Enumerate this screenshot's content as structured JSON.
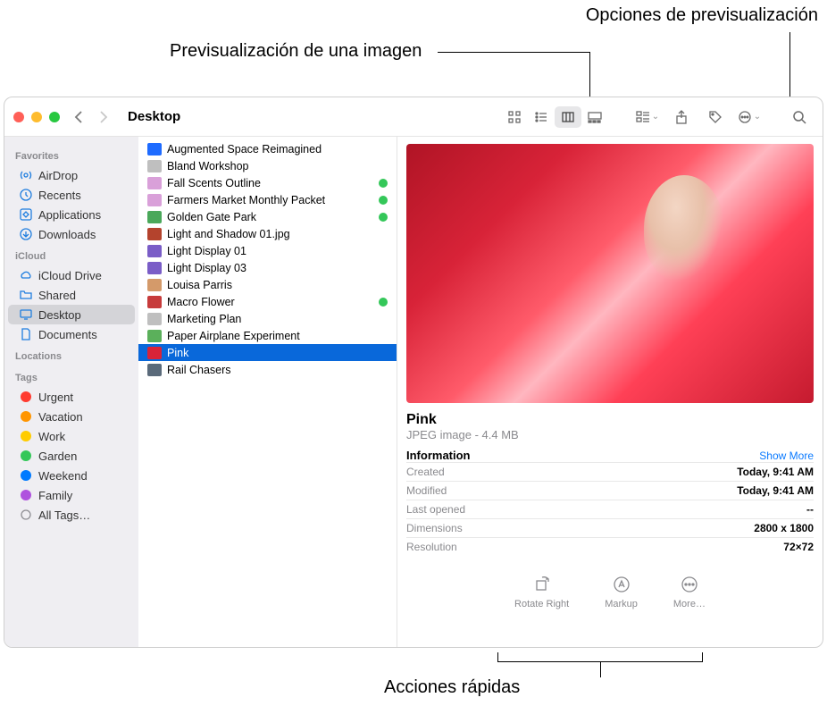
{
  "callouts": {
    "preview_options": "Opciones de previsualización",
    "image_preview": "Previsualización de una imagen",
    "quick_actions": "Acciones rápidas"
  },
  "window": {
    "location": "Desktop"
  },
  "sidebar": {
    "sections": {
      "favorites": "Favorites",
      "icloud": "iCloud",
      "locations": "Locations",
      "tags": "Tags"
    },
    "favorites": [
      {
        "label": "AirDrop",
        "icon": "airdrop"
      },
      {
        "label": "Recents",
        "icon": "clock"
      },
      {
        "label": "Applications",
        "icon": "apps"
      },
      {
        "label": "Downloads",
        "icon": "download"
      }
    ],
    "icloud": [
      {
        "label": "iCloud Drive",
        "icon": "cloud"
      },
      {
        "label": "Shared",
        "icon": "folder"
      },
      {
        "label": "Desktop",
        "icon": "desktop",
        "active": true
      },
      {
        "label": "Documents",
        "icon": "doc"
      }
    ],
    "tags": [
      {
        "label": "Urgent",
        "color": "#ff3b30"
      },
      {
        "label": "Vacation",
        "color": "#ff9500"
      },
      {
        "label": "Work",
        "color": "#ffcc00"
      },
      {
        "label": "Garden",
        "color": "#34c759"
      },
      {
        "label": "Weekend",
        "color": "#007aff"
      },
      {
        "label": "Family",
        "color": "#af52de"
      },
      {
        "label": "All Tags…",
        "color": "",
        "all": true
      }
    ]
  },
  "files": [
    {
      "name": "Augmented Space Reimagined",
      "icon": "pres",
      "tag": false
    },
    {
      "name": "Bland Workshop",
      "icon": "doc",
      "tag": false
    },
    {
      "name": "Fall Scents Outline",
      "icon": "pres2",
      "tag": true
    },
    {
      "name": "Farmers Market Monthly Packet",
      "icon": "pres2",
      "tag": true
    },
    {
      "name": "Golden Gate Park",
      "icon": "img",
      "tag": true
    },
    {
      "name": "Light and Shadow 01.jpg",
      "icon": "img2",
      "tag": false
    },
    {
      "name": "Light Display 01",
      "icon": "img3",
      "tag": false
    },
    {
      "name": "Light Display 03",
      "icon": "img3",
      "tag": false
    },
    {
      "name": "Louisa Parris",
      "icon": "img4",
      "tag": false
    },
    {
      "name": "Macro Flower",
      "icon": "img5",
      "tag": true
    },
    {
      "name": "Marketing Plan",
      "icon": "doc",
      "tag": false
    },
    {
      "name": "Paper Airplane Experiment",
      "icon": "sheet",
      "tag": false
    },
    {
      "name": "Pink",
      "icon": "img6",
      "tag": false,
      "selected": true
    },
    {
      "name": "Rail Chasers",
      "icon": "img7",
      "tag": false
    }
  ],
  "preview": {
    "title": "Pink",
    "subtitle": "JPEG image - 4.4 MB",
    "info_header": "Information",
    "show_more": "Show More",
    "rows": [
      {
        "k": "Created",
        "v": "Today, 9:41 AM"
      },
      {
        "k": "Modified",
        "v": "Today, 9:41 AM"
      },
      {
        "k": "Last opened",
        "v": "--"
      },
      {
        "k": "Dimensions",
        "v": "2800 x 1800"
      },
      {
        "k": "Resolution",
        "v": "72×72"
      }
    ],
    "actions": [
      {
        "label": "Rotate Right",
        "icon": "rotate"
      },
      {
        "label": "Markup",
        "icon": "markup"
      },
      {
        "label": "More…",
        "icon": "more"
      }
    ]
  }
}
